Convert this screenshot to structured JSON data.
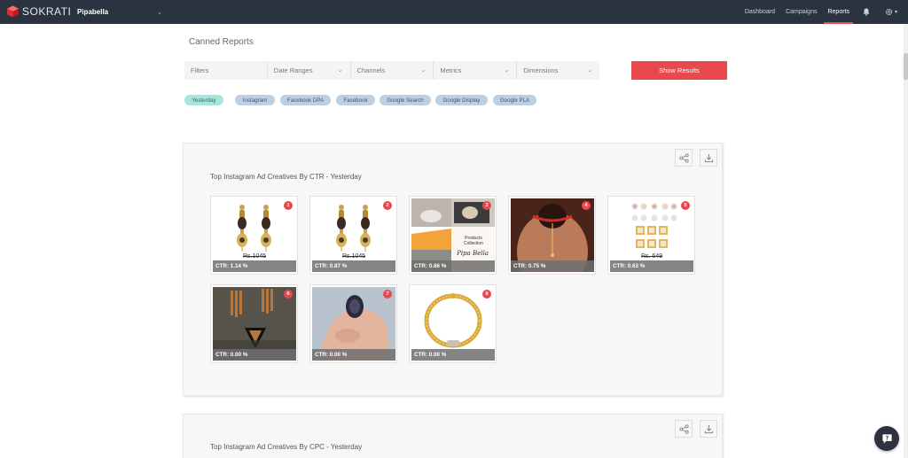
{
  "app": {
    "logo_text": "SOKRATI",
    "brand": "Pipabella"
  },
  "nav": {
    "links": [
      "Dashboard",
      "Campaigns",
      "Reports"
    ],
    "active": "Reports"
  },
  "page": {
    "title": "Canned Reports"
  },
  "filters": {
    "label": "Filters",
    "dropdowns": [
      "Date Ranges",
      "Channels",
      "Metrics",
      "Dimensions"
    ],
    "submit_label": "Show Results"
  },
  "chips": [
    "Yesterday",
    "Instagram",
    "Facebook DPA",
    "Facebook",
    "Google Search",
    "Google Display",
    "Google PLA"
  ],
  "reports": [
    {
      "title": "Top Instagram Ad Creatives By CTR - Yesterday",
      "creatives": [
        {
          "rank": "1",
          "ctr": "CTR: 1.14 %",
          "price": "Rs.1045"
        },
        {
          "rank": "2",
          "ctr": "CTR: 0.87 %",
          "price": "Rs.1045"
        },
        {
          "rank": "3",
          "ctr": "CTR: 0.86 %",
          "caption": "Products Collection",
          "script": "Pipa Bella"
        },
        {
          "rank": "4",
          "ctr": "CTR: 0.75 %"
        },
        {
          "rank": "5",
          "ctr": "CTR: 0.63 %",
          "price": "Rs. 649"
        },
        {
          "rank": "6",
          "ctr": "CTR: 0.00 %"
        },
        {
          "rank": "7",
          "ctr": "CTR: 0.00 %"
        },
        {
          "rank": "8",
          "ctr": "CTR: 0.00 %"
        }
      ]
    },
    {
      "title": "Top Instagram Ad Creatives By CPC - Yesterday"
    }
  ],
  "colors": {
    "nav_bg": "#2b3240",
    "accent_red": "#e8494f",
    "chip_blue": "#bcd0e4",
    "chip_teal": "#a8e6dc"
  }
}
